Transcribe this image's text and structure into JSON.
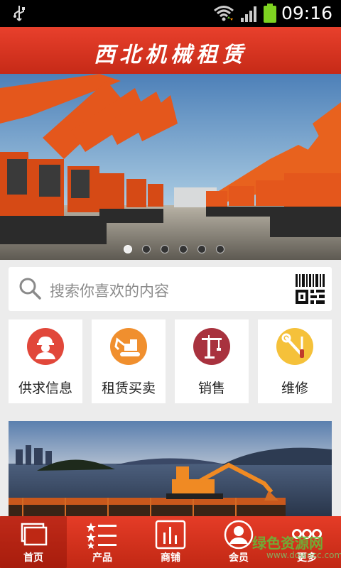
{
  "status_bar": {
    "time": "09:16"
  },
  "header": {
    "title": "西北机械租赁"
  },
  "banner": {
    "slide_count": 6,
    "active_index": 0
  },
  "search": {
    "placeholder": "搜索你喜欢的内容",
    "scan_icon": "qr-code-icon"
  },
  "categories": [
    {
      "label": "供求信息",
      "icon": "worker-icon",
      "color": "#e1473a"
    },
    {
      "label": "租赁买卖",
      "icon": "excavator-icon",
      "color": "#f08f2e"
    },
    {
      "label": "销售",
      "icon": "crane-icon",
      "color": "#a8323e"
    },
    {
      "label": "维修",
      "icon": "tools-icon",
      "color": "#f5c13a"
    }
  ],
  "bottom_nav": [
    {
      "label": "首页",
      "icon": "home-icon",
      "active": true
    },
    {
      "label": "产品",
      "icon": "product-list-icon",
      "active": false
    },
    {
      "label": "商铺",
      "icon": "shop-chart-icon",
      "active": false
    },
    {
      "label": "会员",
      "icon": "member-icon",
      "active": false
    },
    {
      "label": "更多",
      "icon": "more-icon",
      "active": false
    }
  ],
  "watermark": {
    "main": "绿色资源网",
    "sub": "www.downcc.com"
  }
}
